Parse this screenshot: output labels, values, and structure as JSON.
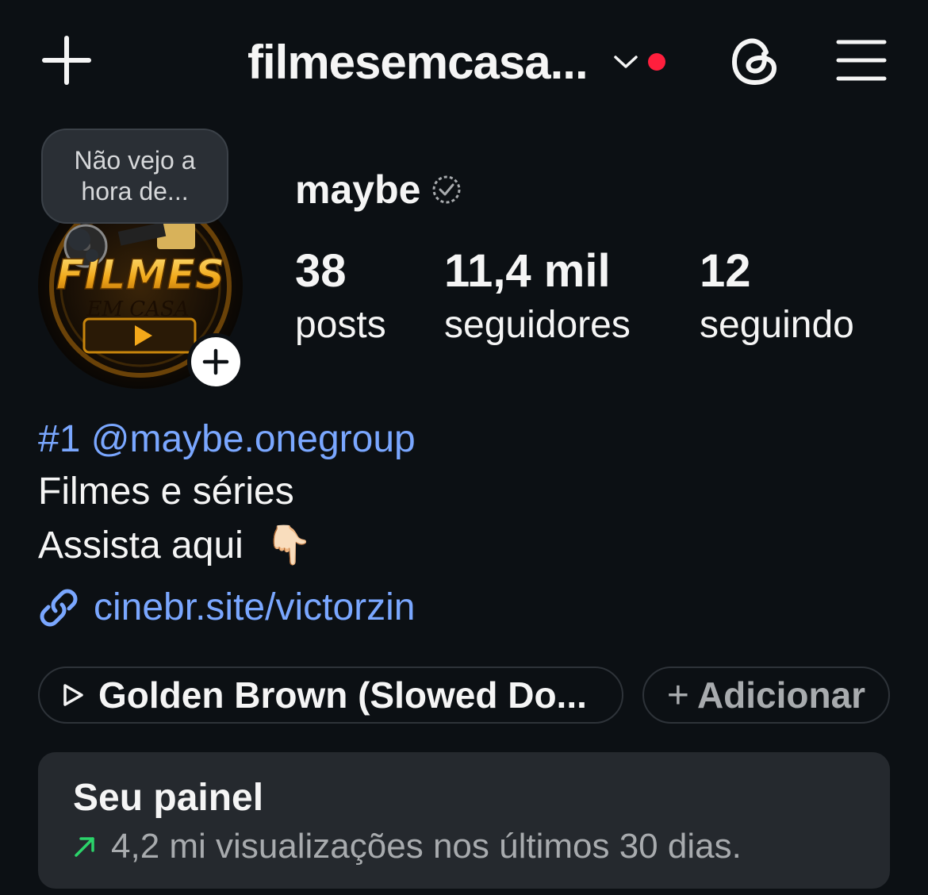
{
  "topbar": {
    "account_name": "filmesemcasa...",
    "notification_dot_color": "#ff1f3d",
    "icons": [
      "plus-icon",
      "chevron-down-icon",
      "threads-icon",
      "hamburger-menu-icon"
    ]
  },
  "profile": {
    "note": "Não vejo a hora de...",
    "avatar_logo_line1": "FILMES",
    "avatar_logo_line2": "EM CASA",
    "display_name": "maybe",
    "stats": {
      "posts_value": "38",
      "posts_label": "posts",
      "followers_value": "11,4 mil",
      "followers_label": "seguidores",
      "following_value": "12",
      "following_label": "seguindo"
    }
  },
  "bio": {
    "line1": "#1 @maybe.onegroup",
    "line2": "Filmes e séries",
    "line3": "Assista aqui",
    "line3_emoji": "👇🏻",
    "link": "cinebr.site/victorzin",
    "link_color": "#7aa7ff"
  },
  "pills": {
    "music": "Golden Brown (Slowed Do...",
    "add_plus": "+",
    "add": "Adicionar"
  },
  "dashboard": {
    "title": "Seu painel",
    "subtitle": "4,2 mi visualizações nos últimos 30 dias.",
    "trend_color": "#2bd46a"
  }
}
